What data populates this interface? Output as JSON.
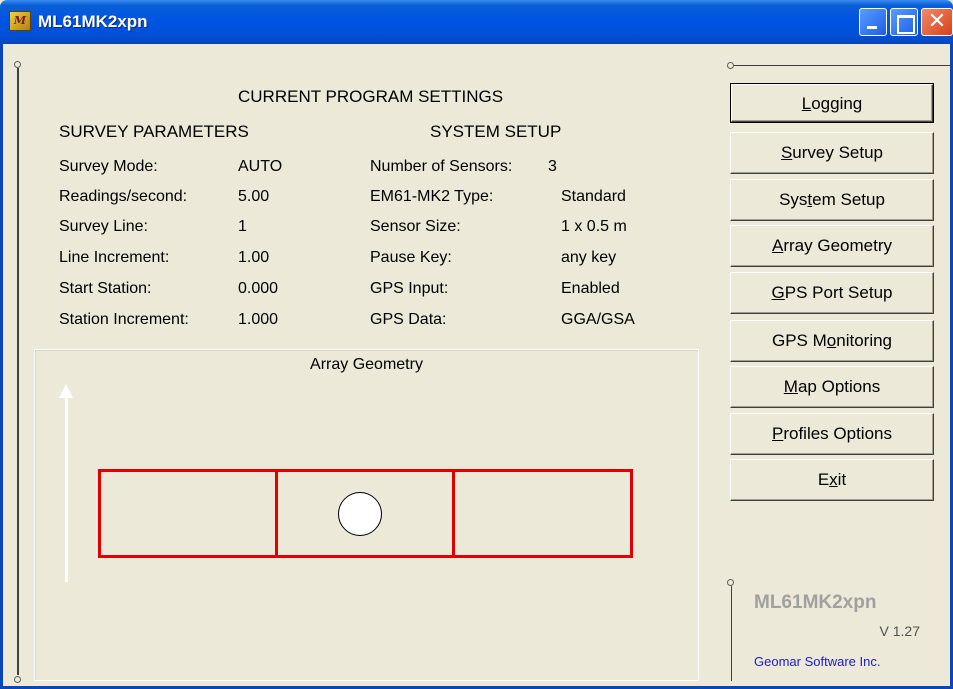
{
  "window": {
    "title": "ML61MK2xpn",
    "app_icon_glyph": "M",
    "close_glyph": "✕"
  },
  "settings": {
    "heading": "CURRENT PROGRAM SETTINGS",
    "survey": {
      "heading": "SURVEY PARAMETERS",
      "rows": [
        {
          "label": "Survey Mode:",
          "value": "AUTO"
        },
        {
          "label": "Readings/second:",
          "value": "5.00"
        },
        {
          "label": "Survey Line:",
          "value": "1"
        },
        {
          "label": "Line Increment:",
          "value": "1.00"
        },
        {
          "label": "Start Station:",
          "value": "0.000"
        },
        {
          "label": "Station Increment:",
          "value": "1.000"
        }
      ]
    },
    "system": {
      "heading": "SYSTEM SETUP",
      "rows": [
        {
          "label": "Number of Sensors:",
          "value": "3"
        },
        {
          "label": "EM61-MK2 Type:",
          "value": "Standard"
        },
        {
          "label": "Sensor Size:",
          "value": "1 x 0.5 m"
        },
        {
          "label": "Pause Key:",
          "value": "any key"
        },
        {
          "label": "GPS Input:",
          "value": "Enabled"
        },
        {
          "label": "GPS Data:",
          "value": "GGA/GSA"
        }
      ]
    }
  },
  "geometry": {
    "title": "Array Geometry",
    "sensor_count": 3,
    "sensor_color": "#e00000"
  },
  "buttons": [
    {
      "pre": "",
      "key": "L",
      "post": "ogging"
    },
    {
      "pre": "",
      "key": "S",
      "post": "urvey Setup"
    },
    {
      "pre": "Sys",
      "key": "t",
      "post": "em Setup"
    },
    {
      "pre": "",
      "key": "A",
      "post": "rray Geometry"
    },
    {
      "pre": "",
      "key": "G",
      "post": "PS Port Setup"
    },
    {
      "pre": "GPS M",
      "key": "o",
      "post": "nitoring"
    },
    {
      "pre": "",
      "key": "M",
      "post": "ap Options"
    },
    {
      "pre": "",
      "key": "P",
      "post": "rofiles Options"
    },
    {
      "pre": "E",
      "key": "x",
      "post": "it"
    }
  ],
  "brand": {
    "name": "ML61MK2xpn",
    "version": "V 1.27",
    "company": "Geomar Software Inc."
  },
  "colors": {
    "titlebar": "#0054e3",
    "window_bg": "#ece9d8",
    "company_link": "#2020c0"
  }
}
